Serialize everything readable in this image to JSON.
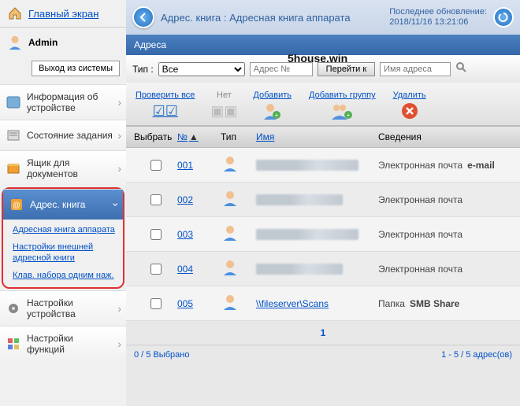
{
  "home_label": "Главный экран",
  "user": {
    "name": "Admin"
  },
  "logout": "Выход из системы",
  "watermark": "5house.win",
  "sidebar": {
    "items": [
      {
        "label": "Информация об устройстве",
        "icon": "info-icon"
      },
      {
        "label": "Состояние задания",
        "icon": "jobs-icon"
      },
      {
        "label": "Ящик для документов",
        "icon": "box-icon"
      },
      {
        "label": "Адрес. книга",
        "icon": "addressbook-icon",
        "active": true,
        "sub": [
          {
            "label": "Адресная книга аппарата"
          },
          {
            "label": "Настройки внешней адресной книги"
          },
          {
            "label": "Клав. набора одним наж."
          }
        ]
      },
      {
        "label": "Настройки устройства",
        "icon": "settings-icon"
      },
      {
        "label": "Настройки функций",
        "icon": "functions-icon"
      }
    ]
  },
  "breadcrumb": "Адрес. книга : Адресная книга аппарата",
  "updated_label": "Последнее обновление:",
  "updated_value": "2018/11/16 13:21:06",
  "panel_title": "Адреса",
  "filters": {
    "type_label": "Тип :",
    "type_value": "Все",
    "num_placeholder": "Адрес №",
    "go_label": "Перейти к",
    "name_placeholder": "Имя адреса"
  },
  "toolbar": {
    "check_all": "Проверить все",
    "none": "Нет",
    "add": "Добавить",
    "add_group": "Добавить группу",
    "delete": "Удалить"
  },
  "columns": {
    "select": "Выбрать",
    "number": "№",
    "type": "Тип",
    "name": "Имя",
    "info": "Сведения"
  },
  "rows": [
    {
      "num": "001",
      "name_blur": true,
      "info": "Электронная почта",
      "extra": "e-mail"
    },
    {
      "num": "002",
      "name_blur": true,
      "info": "Электронная почта",
      "extra": ""
    },
    {
      "num": "003",
      "name_blur": true,
      "info": "Электронная почта",
      "extra": ""
    },
    {
      "num": "004",
      "name_blur": true,
      "info": "Электронная почта",
      "extra": ""
    },
    {
      "num": "005",
      "name_text": "\\\\fileserver\\Scans",
      "info": "Папка",
      "extra": "SMB Share"
    }
  ],
  "pager_page": "1",
  "footer_left": "0 / 5 Выбрано",
  "footer_right": "1 - 5 / 5 адрес(ов)"
}
